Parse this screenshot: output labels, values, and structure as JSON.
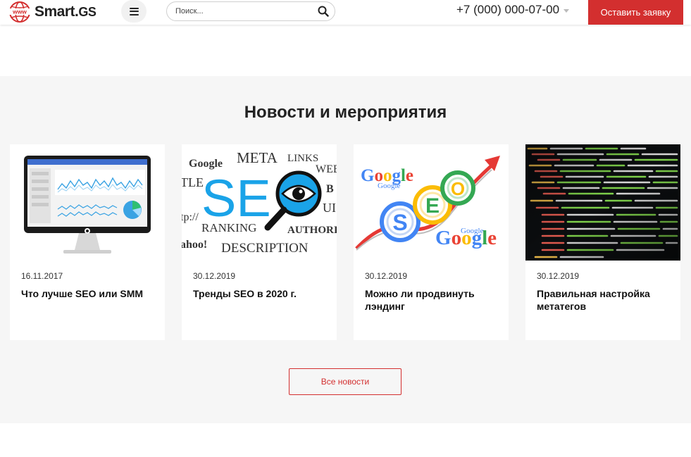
{
  "header": {
    "logo_main": "Smart.",
    "logo_suffix": "GS",
    "search_placeholder": "Поиск...",
    "phone": "+7 (000) 000-07-00",
    "cta_label": "Оставить заявку"
  },
  "news": {
    "title": "Новости и мероприятия",
    "cards": [
      {
        "date": "16.11.2017",
        "title": "Что лучше SEO или SMM"
      },
      {
        "date": "30.12.2019",
        "title": "Тренды SEO в 2020 г."
      },
      {
        "date": "30.12.2019",
        "title": "Можно ли продвинуть лэндинг"
      },
      {
        "date": "30.12.2019",
        "title": "Правильная настройка метатегов"
      }
    ],
    "more_label": "Все новости"
  },
  "images": {
    "seo_words": [
      "Google",
      "META",
      "LINKS",
      "WEB",
      "TLE",
      "B",
      "UI",
      "tp://",
      "RANKING",
      "AUTHORI",
      "ahoo!",
      "DESCRIPTION"
    ],
    "seo_big": "SE",
    "google": "Google",
    "seo_letters": [
      "S",
      "E",
      "O"
    ]
  },
  "colors": {
    "accent": "#d32f2f",
    "section_bg": "#f6f6f6"
  }
}
